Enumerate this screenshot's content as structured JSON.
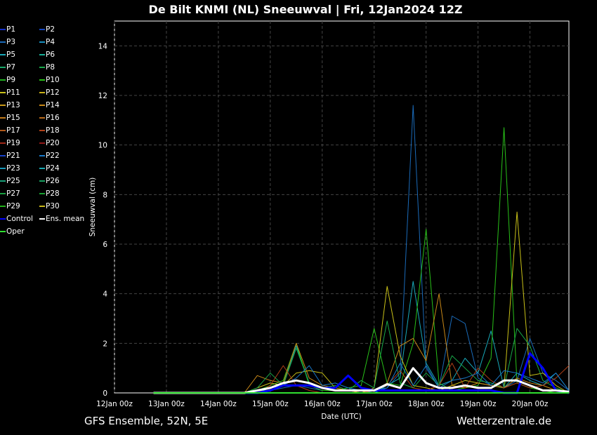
{
  "title": "De Bilt KNMI  (NL)  Sneeuwval | Fri, 12Jan2024 12Z",
  "footer": {
    "left": "GFS Ensemble, 52N, 5E",
    "right": "Wetterzentrale.de"
  },
  "legend": [
    {
      "label": "P1",
      "color": "#1530c8"
    },
    {
      "label": "P2",
      "color": "#1545c0"
    },
    {
      "label": "P3",
      "color": "#1a6ab8"
    },
    {
      "label": "P4",
      "color": "#1890c0"
    },
    {
      "label": "P5",
      "color": "#18a8b8"
    },
    {
      "label": "P6",
      "color": "#18b098"
    },
    {
      "label": "P7",
      "color": "#18a868"
    },
    {
      "label": "P8",
      "color": "#18a848"
    },
    {
      "label": "P9",
      "color": "#20b020"
    },
    {
      "label": "P10",
      "color": "#28c018"
    },
    {
      "label": "P11",
      "color": "#c8c018"
    },
    {
      "label": "P12",
      "color": "#c8b018"
    },
    {
      "label": "P13",
      "color": "#c89818"
    },
    {
      "label": "P14",
      "color": "#c88818"
    },
    {
      "label": "P15",
      "color": "#c07818"
    },
    {
      "label": "P16",
      "color": "#b86818"
    },
    {
      "label": "P17",
      "color": "#b05818"
    },
    {
      "label": "P18",
      "color": "#b04018"
    },
    {
      "label": "P19",
      "color": "#a02818"
    },
    {
      "label": "P20",
      "color": "#901818"
    },
    {
      "label": "P21",
      "color": "#1540c8"
    },
    {
      "label": "P22",
      "color": "#1878c8"
    },
    {
      "label": "P23",
      "color": "#1898b8"
    },
    {
      "label": "P24",
      "color": "#18a8b0"
    },
    {
      "label": "P25",
      "color": "#18a078"
    },
    {
      "label": "P26",
      "color": "#18a060"
    },
    {
      "label": "P27",
      "color": "#18a040"
    },
    {
      "label": "P28",
      "color": "#18a030"
    },
    {
      "label": "P29",
      "color": "#20b018"
    },
    {
      "label": "P30",
      "color": "#c8b818"
    },
    {
      "label": "Control",
      "color": "#0000ff"
    },
    {
      "label": "Ens. mean",
      "color": "#ffffff"
    },
    {
      "label": "Oper",
      "color": "#30e030"
    }
  ],
  "chart_data": {
    "type": "line",
    "title": "De Bilt KNMI  (NL)  Sneeuwval | Fri, 12Jan2024 12Z",
    "xlabel": "Date (UTC)",
    "ylabel": "Sneeuwval (cm)",
    "xlim_hours": [
      0,
      210
    ],
    "ylim": [
      0,
      15
    ],
    "grid": true,
    "x_hours_start": 18,
    "x_hours_step": 6,
    "xticks": [
      {
        "h": 0,
        "label": "12Jan 00z"
      },
      {
        "h": 24,
        "label": "13Jan 00z"
      },
      {
        "h": 48,
        "label": "14Jan 00z"
      },
      {
        "h": 72,
        "label": "15Jan 00z"
      },
      {
        "h": 96,
        "label": "16Jan 00z"
      },
      {
        "h": 120,
        "label": "17Jan 00z"
      },
      {
        "h": 144,
        "label": "18Jan 00z"
      },
      {
        "h": 168,
        "label": "19Jan 00z"
      },
      {
        "h": 192,
        "label": "20Jan 00z"
      }
    ],
    "yticks": [
      0,
      2,
      4,
      6,
      8,
      10,
      12,
      14
    ],
    "series": [
      {
        "name": "P3",
        "color": "#1a6ab8",
        "width": 1,
        "values": [
          0,
          0,
          0,
          0,
          0,
          0,
          0,
          0,
          0,
          0.1,
          0.2,
          0.3,
          0.2,
          0.1,
          0.1,
          0.2,
          0.1,
          0,
          0.2,
          0.8,
          11.6,
          1.0,
          0.2,
          3.1,
          2.8,
          0.6,
          0.3,
          0.2,
          0.5,
          2.2,
          0.8,
          0.5,
          0.1
        ]
      },
      {
        "name": "P5",
        "color": "#18a8b8",
        "width": 1,
        "values": [
          0,
          0,
          0,
          0,
          0,
          0,
          0,
          0,
          0,
          0.2,
          0.3,
          1.9,
          0.4,
          0.2,
          0.1,
          0.1,
          0,
          0,
          0.3,
          0.6,
          4.5,
          1.2,
          0.3,
          0.5,
          1.4,
          0.8,
          2.5,
          0.2,
          0.8,
          0.5,
          0.3,
          0.8,
          0.1
        ]
      },
      {
        "name": "P10",
        "color": "#28c018",
        "width": 1,
        "values": [
          0,
          0,
          0,
          0,
          0,
          0,
          0,
          0,
          0.1,
          0.3,
          0.5,
          2.0,
          0.3,
          0.1,
          0.1,
          0.2,
          0.3,
          2.6,
          0.4,
          0.3,
          2.0,
          6.6,
          0.4,
          0.1,
          0.2,
          0.3,
          1.4,
          10.7,
          0.4,
          0.2,
          0.1,
          0,
          0
        ]
      },
      {
        "name": "P11",
        "color": "#c8c018",
        "width": 1,
        "values": [
          0,
          0,
          0,
          0,
          0,
          0,
          0,
          0,
          0.2,
          0.4,
          0.3,
          0.8,
          0.9,
          0.8,
          0.2,
          0.1,
          0,
          0.2,
          4.3,
          1.5,
          0.3,
          0.2,
          0.1,
          0.3,
          0.5,
          0.4,
          0.3,
          0.2,
          7.3,
          0.7,
          0.8,
          0.3,
          0
        ]
      },
      {
        "name": "P14",
        "color": "#c88818",
        "width": 1,
        "values": [
          0,
          0,
          0,
          0,
          0,
          0,
          0,
          0,
          0.7,
          0.5,
          0.4,
          2.0,
          0.6,
          0.3,
          0.2,
          0.1,
          0,
          0.1,
          0.4,
          1.9,
          2.2,
          1.3,
          4.0,
          0.3,
          0.2,
          0.4,
          0.3,
          0.2,
          0.6,
          0.4,
          0.3,
          0.1,
          0
        ]
      },
      {
        "name": "P8",
        "color": "#18a848",
        "width": 1,
        "values": [
          0,
          0,
          0,
          0,
          0,
          0,
          0,
          0,
          0.2,
          0.8,
          0.3,
          1.8,
          0.4,
          0.2,
          0.3,
          0.1,
          0.5,
          0.2,
          2.9,
          0.4,
          0.2,
          0.8,
          0.3,
          1.5,
          1.0,
          0.5,
          0.4,
          0.2,
          2.6,
          1.9,
          0.5,
          0.2,
          0
        ]
      },
      {
        "name": "P18",
        "color": "#b04018",
        "width": 1,
        "values": [
          0,
          0,
          0,
          0,
          0,
          0,
          0,
          0,
          0,
          0.3,
          1.1,
          0.3,
          0.1,
          0,
          0,
          0,
          0,
          0.1,
          0.3,
          0.9,
          0.2,
          0.1,
          0.3,
          1.2,
          0.2,
          1.0,
          0.5,
          0.2,
          0.4,
          0.2,
          0.3,
          0.6,
          1.1
        ]
      },
      {
        "name": "P22",
        "color": "#1878c8",
        "width": 1,
        "values": [
          0,
          0,
          0,
          0,
          0,
          0,
          0,
          0,
          0.1,
          0.2,
          0.3,
          0.6,
          1.1,
          0.3,
          0.4,
          0.2,
          0.1,
          0.1,
          0.2,
          1.2,
          0.3,
          1.1,
          0.2,
          0.5,
          0.6,
          0.8,
          0.3,
          0.9,
          0.8,
          0.6,
          0.4,
          0.8,
          0.1
        ]
      },
      {
        "name": "Control",
        "color": "#0000ff",
        "width": 3,
        "values": [
          0,
          0,
          0,
          0,
          0,
          0,
          0,
          0,
          0,
          0.1,
          0.3,
          0.3,
          0.3,
          0.2,
          0.2,
          0.7,
          0.2,
          0.1,
          0.1,
          0.1,
          0.1,
          0.1,
          0.1,
          0.1,
          0.1,
          0.1,
          0.1,
          0,
          0,
          1.6,
          1.0,
          0.1,
          0
        ]
      },
      {
        "name": "Ens. mean",
        "color": "#ffffff",
        "width": 3,
        "values": [
          0,
          0,
          0,
          0,
          0,
          0,
          0,
          0,
          0.1,
          0.2,
          0.4,
          0.5,
          0.4,
          0.2,
          0.1,
          0.1,
          0.1,
          0.1,
          0.35,
          0.2,
          1.0,
          0.4,
          0.2,
          0.2,
          0.3,
          0.2,
          0.2,
          0.5,
          0.5,
          0.3,
          0.1,
          0.1,
          0.05
        ]
      },
      {
        "name": "Oper",
        "color": "#30e030",
        "width": 2,
        "values": [
          0,
          0,
          0,
          0,
          0,
          0,
          0,
          0,
          0,
          0,
          0,
          0,
          0,
          0,
          0,
          0,
          0,
          0,
          0,
          0,
          0,
          0,
          0,
          0,
          0,
          0,
          0,
          0,
          0,
          0,
          0,
          0,
          0
        ]
      }
    ]
  }
}
